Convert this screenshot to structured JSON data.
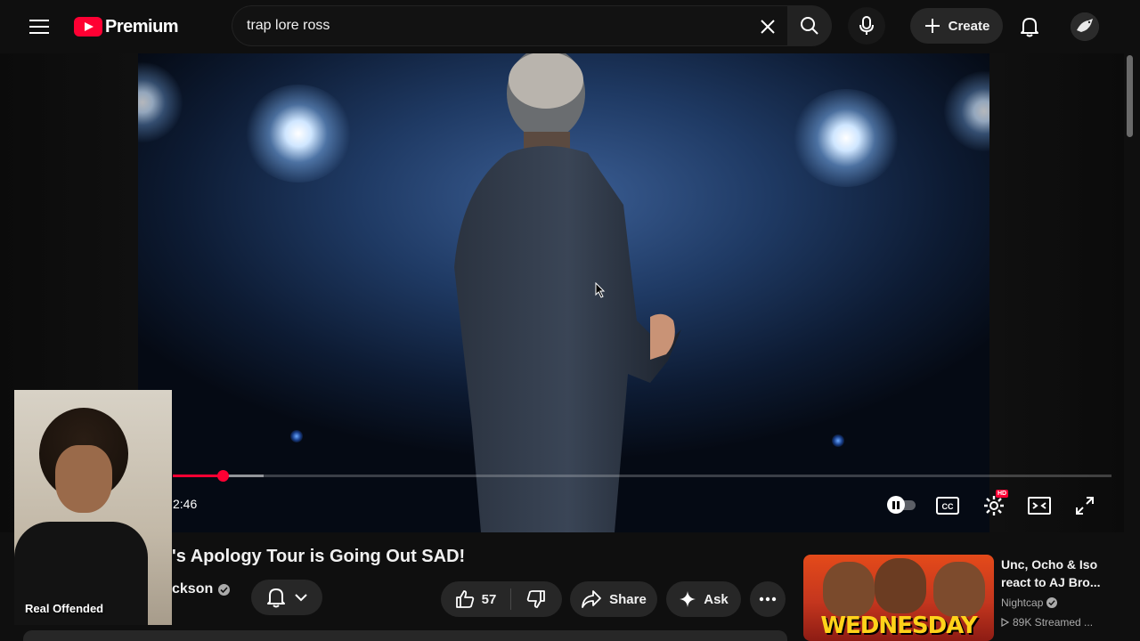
{
  "header": {
    "logo_text": "Premium",
    "search": {
      "value": "trap lore ross",
      "placeholder": "Search"
    },
    "create_label": "Create"
  },
  "player": {
    "current_time": "2:46",
    "progress_fraction": 0.053,
    "buffered_fraction": 0.097,
    "accent_color": "#ff0033",
    "hd_badge": "HD",
    "controls": [
      "autoplay-toggle",
      "cc-icon",
      "settings-icon",
      "theater-mode-icon",
      "fullscreen-icon"
    ]
  },
  "video": {
    "title": "'s Apology Tour is Going Out SAD!",
    "channel": "ckson",
    "like_count": "57",
    "share_label": "Share",
    "ask_label": "Ask"
  },
  "related": {
    "title": "Unc, Ocho & Iso react to AJ Bro...",
    "channel": "Nightcap",
    "meta": "89K  Streamed ...",
    "thumb_word": "WEDNESDAY"
  },
  "webcam": {
    "label": "Real Offended"
  }
}
